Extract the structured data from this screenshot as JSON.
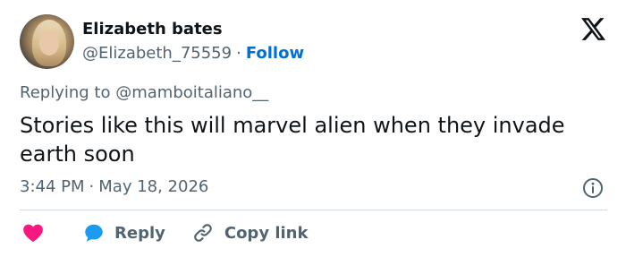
{
  "author": {
    "name": "Elizabeth bates",
    "handle": "@Elizabeth_75559",
    "separator": "·",
    "follow_label": "Follow"
  },
  "reply_context": {
    "prefix": "Replying to",
    "mention": "@mamboitaliano__"
  },
  "tweet": {
    "text": "Stories like this will marvel alien when they invade earth soon"
  },
  "meta": {
    "time": "3:44 PM",
    "separator": "·",
    "date": "May 18, 2026"
  },
  "actions": {
    "like_icon": "heart-icon",
    "reply_label": "Reply",
    "copy_label": "Copy link"
  },
  "colors": {
    "accent": "#006fd6",
    "like": "#f91880",
    "reply_bubble": "#1d9bf0",
    "muted": "#536471",
    "text": "#0f1419",
    "divider": "#cfd9de"
  }
}
